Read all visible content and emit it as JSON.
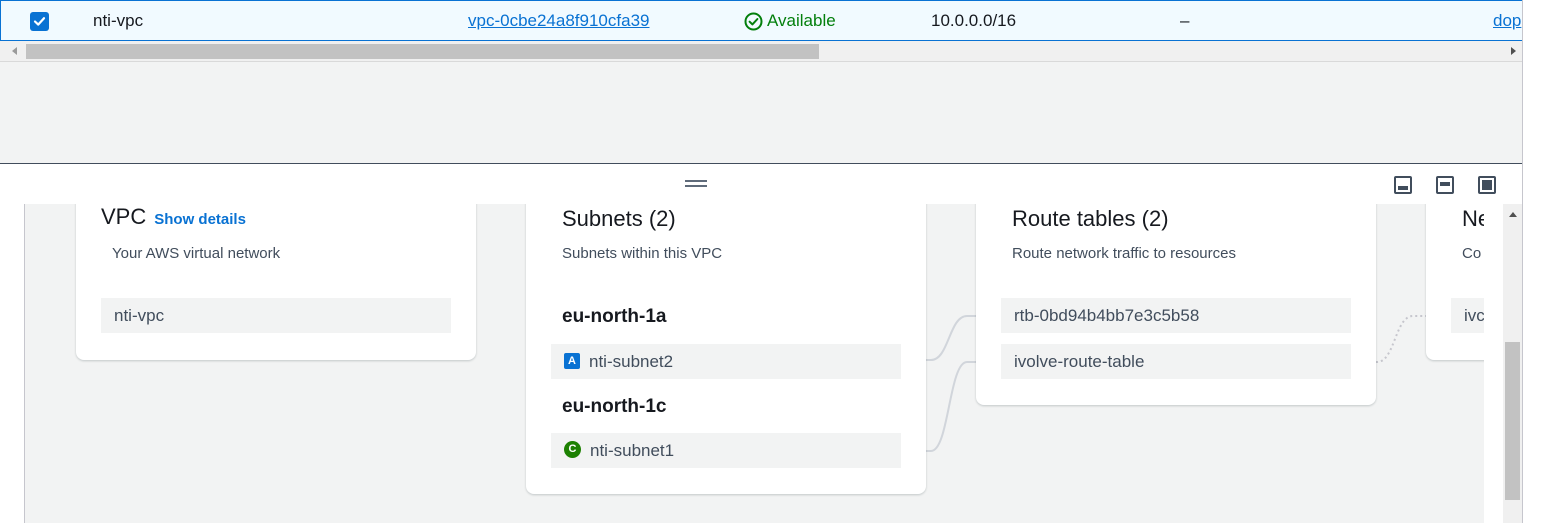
{
  "table": {
    "row": {
      "selected": true,
      "name": "nti-vpc",
      "vpc_id": "vpc-0cbe24a8f910cfa39",
      "state": "Available",
      "ipv4_cidr": "10.0.0.0/16",
      "ipv6_cidr": "–",
      "truncated_link": "dop"
    }
  },
  "diagram": {
    "vpc": {
      "title": "VPC",
      "show_details": "Show details",
      "subtitle": "Your AWS virtual network",
      "item": "nti-vpc"
    },
    "subnets": {
      "title": "Subnets (2)",
      "subtitle": "Subnets within this VPC",
      "zones": [
        {
          "name": "eu-north-1a",
          "subnet": "nti-subnet2",
          "badge": "A"
        },
        {
          "name": "eu-north-1c",
          "subnet": "nti-subnet1",
          "badge": "C"
        }
      ]
    },
    "route_tables": {
      "title": "Route tables (2)",
      "subtitle": "Route network traffic to resources",
      "items": [
        "rtb-0bd94b4bb7e3c5b58",
        "ivolve-route-table"
      ]
    },
    "network_connections": {
      "title": "Ne",
      "subtitle": "Co",
      "item": "ivc"
    }
  },
  "colors": {
    "accent": "#0972d3",
    "success": "#037f0c",
    "badge_c": "#1d8102"
  }
}
